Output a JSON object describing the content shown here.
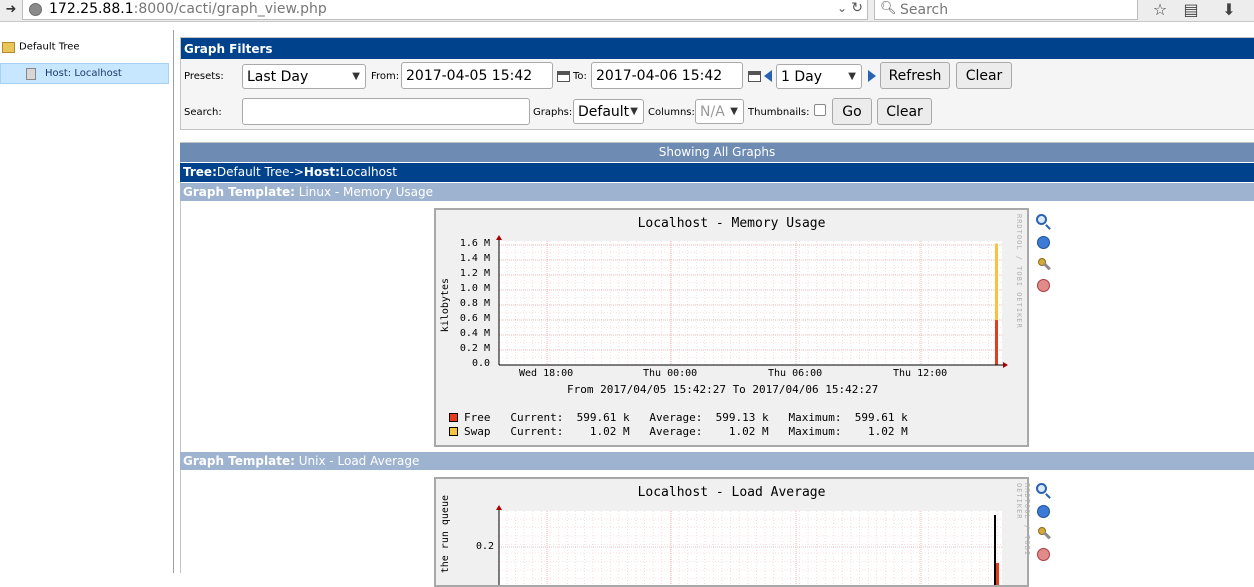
{
  "browser": {
    "url_host": "172.25.88.1",
    "url_path": ":8000/cacti/graph_view.php",
    "search_placeholder": "Search"
  },
  "tree": {
    "root_label": "Default Tree",
    "host_label": "Host: Localhost"
  },
  "filters": {
    "title": "Graph Filters",
    "presets_label": "Presets:",
    "presets_value": "Last Day",
    "from_label": "From:",
    "from_value": "2017-04-05 15:42",
    "to_label": "To:",
    "to_value": "2017-04-06 15:42",
    "span_value": "1 Day",
    "refresh_label": "Refresh",
    "clear_label": "Clear",
    "search_label": "Search:",
    "search_value": "",
    "graphs_label": "Graphs:",
    "graphs_value": "Default",
    "columns_label": "Columns:",
    "columns_value": "N/A",
    "thumbnails_label": "Thumbnails:",
    "go_label": "Go",
    "clear2_label": "Clear"
  },
  "showing_bar": "Showing All Graphs",
  "tree_bar": {
    "tree_key": "Tree:",
    "tree_value": "Default Tree->",
    "host_key": "Host:",
    "host_value": "Localhost"
  },
  "templates": [
    {
      "key": "Graph Template:",
      "value": "Linux - Memory Usage"
    },
    {
      "key": "Graph Template:",
      "value": "Unix - Load Average"
    }
  ],
  "graph1": {
    "title": "Localhost - Memory Usage",
    "rrd_credit": "RRDTOOL / TOBI OETIKER",
    "ylabel": "kilobytes",
    "from_to": "From 2017/04/05 15:42:27 To 2017/04/06 15:42:27",
    "legend": [
      {
        "name": "Free",
        "current": "599.61 k",
        "average": "599.13 k",
        "maximum": "599.61 k",
        "color": "#e63c1e"
      },
      {
        "name": "Swap",
        "current": "1.02 M",
        "average": "1.02 M",
        "maximum": "1.02 M",
        "color": "#f5c342"
      }
    ],
    "legend_rows": [
      "Free   Current:  599.61 k   Average:  599.13 k   Maximum:  599.61 k",
      "Swap   Current:    1.02 M   Average:    1.02 M   Maximum:    1.02 M"
    ]
  },
  "graph2": {
    "title": "Localhost - Load Average",
    "rrd_credit": "RRDTOOL / TOBI OETIKER",
    "ylabel": "the run queue"
  },
  "chart_data": [
    {
      "type": "area",
      "title": "Localhost - Memory Usage",
      "ylabel": "kilobytes",
      "y_ticks": [
        "0.0",
        "0.2 M",
        "0.4 M",
        "0.6 M",
        "0.8 M",
        "1.0 M",
        "1.2 M",
        "1.4 M",
        "1.6 M"
      ],
      "x_ticks": [
        "Wed 18:00",
        "Thu 00:00",
        "Thu 06:00",
        "Thu 12:00"
      ],
      "ylim": [
        0,
        1.6
      ],
      "series": [
        {
          "name": "Free",
          "color": "#e63c1e",
          "values_M": [
            0.5996
          ]
        },
        {
          "name": "Swap",
          "color": "#f5c342",
          "values_M": [
            1.02
          ]
        }
      ],
      "grid": true
    },
    {
      "type": "area",
      "title": "Localhost - Load Average",
      "ylabel": "the run queue",
      "y_ticks": [
        "0.2"
      ],
      "grid": true
    }
  ]
}
